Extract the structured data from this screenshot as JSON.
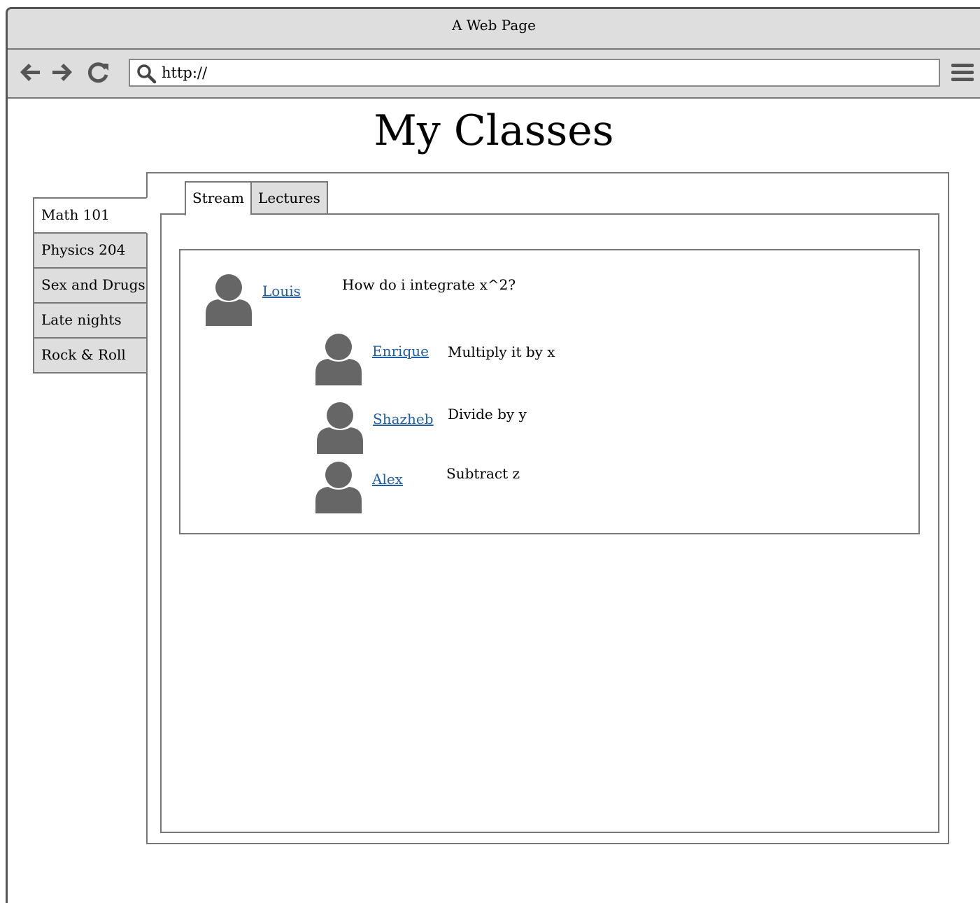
{
  "window": {
    "title": "A Web Page"
  },
  "toolbar": {
    "back_icon": "arrow-left-icon",
    "forward_icon": "arrow-right-icon",
    "reload_icon": "reload-icon",
    "search_icon": "search-icon",
    "menu_icon": "hamburger-menu-icon",
    "url": "http://"
  },
  "page": {
    "title": "My Classes"
  },
  "classes": {
    "active_index": 0,
    "items": [
      {
        "label": "Math 101"
      },
      {
        "label": "Physics 204"
      },
      {
        "label": "Sex and Drugs"
      },
      {
        "label": "Late nights"
      },
      {
        "label": "Rock & Roll"
      }
    ]
  },
  "tabs": {
    "active_index": 0,
    "items": [
      {
        "label": "Stream"
      },
      {
        "label": "Lectures"
      }
    ]
  },
  "stream": {
    "question": {
      "author": "Louis",
      "text": "How do i integrate x^2?"
    },
    "replies": [
      {
        "author": "Enrique",
        "text": "Multiply it by x"
      },
      {
        "author": "Shazheb",
        "text": "Divide by y"
      },
      {
        "author": "Alex",
        "text": "Subtract z"
      }
    ]
  },
  "colors": {
    "chrome": "#dedede",
    "border": "#777777",
    "link": "#1f5fa8",
    "avatar": "#666666"
  }
}
